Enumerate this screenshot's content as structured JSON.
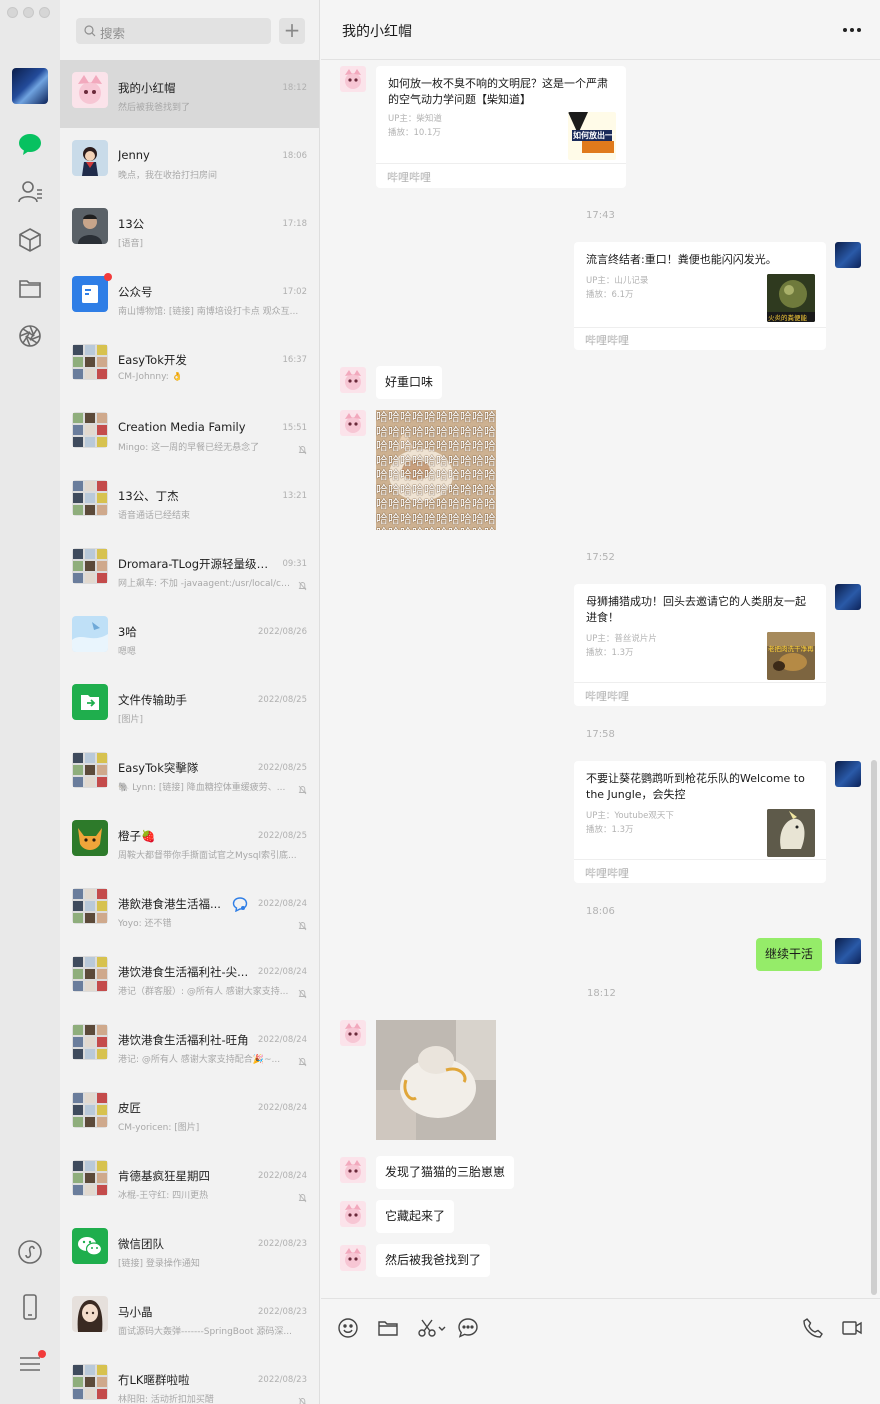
{
  "search": {
    "placeholder": "搜索",
    "add_label": "+"
  },
  "chats": [
    {
      "name": "我的小红帽",
      "time": "18:12",
      "preview": "然后被我爸找到了",
      "active": true,
      "avatar": "pink"
    },
    {
      "name": "Jenny",
      "time": "18:06",
      "preview": "晚点，我在收拾打扫房间",
      "avatar": "anime"
    },
    {
      "name": "13公",
      "time": "17:18",
      "preview": "[语音]",
      "avatar": "dark"
    },
    {
      "name": "公众号",
      "time": "17:02",
      "preview": "南山博物馆: [链接] 南博培设打卡点 观众互...",
      "avatar": "blue",
      "unread": true
    },
    {
      "name": "EasyTok开发",
      "time": "16:37",
      "preview": "CM-Johnny: 👌",
      "avatar": "grid"
    },
    {
      "name": "Creation Media Family",
      "time": "15:51",
      "preview": "Mingo: 这一周的早餐已经无悬念了",
      "avatar": "grid",
      "muted": true
    },
    {
      "name": "13公、丁杰",
      "time": "13:21",
      "preview": "语音通话已经结束",
      "avatar": "grid"
    },
    {
      "name": "Dromara-TLog开源轻量级日...",
      "time": "09:31",
      "preview": "网上飙车: 不加 -javaagent:/usr/local/cu...",
      "avatar": "grid",
      "muted": true
    },
    {
      "name": "3哈",
      "time": "2022/08/26",
      "preview": "嗯嗯",
      "avatar": "sky"
    },
    {
      "name": "文件传输助手",
      "time": "2022/08/25",
      "preview": "[图片]",
      "avatar": "green-file"
    },
    {
      "name": "EasyTok突擊隊",
      "time": "2022/08/25",
      "preview": "🐘 Lynn: [链接] 降血糖控体重缓疲劳、...",
      "avatar": "grid",
      "muted": true
    },
    {
      "name": "橙子🍓",
      "time": "2022/08/25",
      "preview": "周鞍大都督带你手撕面试官之Mysql索引底...",
      "avatar": "cat"
    },
    {
      "name": "港飲港食港生活福...",
      "time": "2022/08/24",
      "preview": "Yoyo: 还不错",
      "avatar": "grid",
      "muted": true,
      "bubble_icon": true
    },
    {
      "name": "港饮港食生活福利社-尖...",
      "time": "2022/08/24",
      "preview": "港记（群客服）: @所有人 感谢大家支持...",
      "avatar": "grid",
      "muted": true
    },
    {
      "name": "港饮港食生活福利社-旺角",
      "time": "2022/08/24",
      "preview": "港记: @所有人 感谢大家支持配合🎉~...",
      "avatar": "grid",
      "muted": true
    },
    {
      "name": "皮匠",
      "time": "2022/08/24",
      "preview": "CM-yoricen: [图片]",
      "avatar": "grid"
    },
    {
      "name": "肯德基疯狂星期四",
      "time": "2022/08/24",
      "preview": "冰棍-王守红: 四川更热",
      "avatar": "grid",
      "muted": true
    },
    {
      "name": "微信团队",
      "time": "2022/08/23",
      "preview": "[链接] 登录操作通知",
      "avatar": "wechat"
    },
    {
      "name": "马小晶",
      "time": "2022/08/23",
      "preview": "面试源码大轰弹-------SpringBoot 源码深...",
      "avatar": "girl"
    },
    {
      "name": "冇LK暱群啦啦",
      "time": "2022/08/23",
      "preview": "林阳阳: 活动折扣加买醋",
      "avatar": "grid",
      "muted": true
    }
  ],
  "conversation": {
    "title": "我的小红帽",
    "card1": {
      "title": "如何放一枚不臭不响的文明屁？这是一个严肃的空气动力学问题【柴知道】",
      "up": "UP主：柴知道",
      "plays": "播放：10.1万",
      "source": "哔哩哔哩",
      "thumb_text": "如何放出一个好屁"
    },
    "time1": "17:43",
    "card2": {
      "title": "流言终结者:重口！粪便也能闪闪发光。",
      "up": "UP主：山儿记录",
      "plays": "播放：6.1万",
      "source": "哔哩哔哩",
      "thumb_text": "火炎的粪便能"
    },
    "msg_good_taste": "好重口味",
    "haha_text": "哈哈哈哈哈哈哈哈哈",
    "time2": "17:52",
    "card3": {
      "title": "母狮捕猎成功！回头去邀请它的人类朋友一起进食！",
      "up": "UP主：普丝说片片",
      "plays": "播放：1.3万",
      "source": "哔哩哔哩",
      "thumb_text": "老把肉洗干净再"
    },
    "time3": "17:58",
    "card4": {
      "title": "不要让葵花鹦鹉听到枪花乐队的Welcome to the Jungle，会失控",
      "up": "UP主：Youtube观天下",
      "plays": "播放：1.3万",
      "source": "哔哩哔哩"
    },
    "time4": "18:06",
    "msg_keep_working": "继续干活",
    "time5": "18:12",
    "msg_three": "发现了猫猫的三胎崽崽",
    "msg_hidden": "它藏起来了",
    "msg_found": "然后被我爸找到了"
  },
  "colors": {
    "bubble_green": "#95ec69",
    "accent_green": "#07c160",
    "unread_red": "#f23b3b"
  }
}
